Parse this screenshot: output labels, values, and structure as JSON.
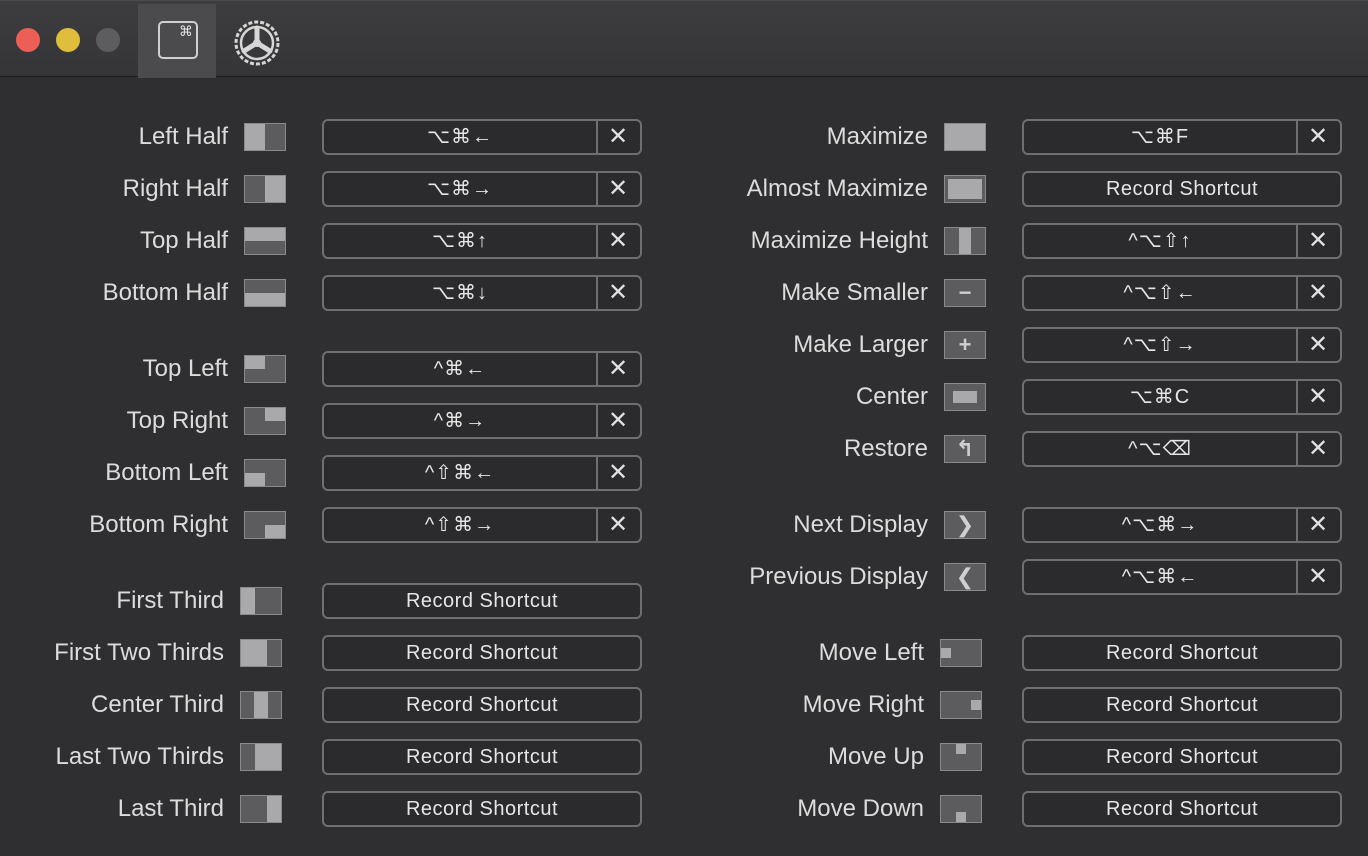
{
  "titlebar": {
    "keyboard_tab_symbol": "⌘",
    "icons": [
      "keyboard-shortcuts-icon",
      "gear-icon"
    ]
  },
  "record_placeholder": "Record Shortcut",
  "clear_symbol": "✕",
  "left_column": [
    {
      "label": "Left Half",
      "icon": "left-half-icon",
      "shortcut": "⌥⌘←"
    },
    {
      "label": "Right Half",
      "icon": "right-half-icon",
      "shortcut": "⌥⌘→"
    },
    {
      "label": "Top Half",
      "icon": "top-half-icon",
      "shortcut": "⌥⌘↑"
    },
    {
      "label": "Bottom Half",
      "icon": "bottom-half-icon",
      "shortcut": "⌥⌘↓"
    },
    {
      "label": "Top Left",
      "icon": "top-left-icon",
      "shortcut": "^⌘←"
    },
    {
      "label": "Top Right",
      "icon": "top-right-icon",
      "shortcut": "^⌘→"
    },
    {
      "label": "Bottom Left",
      "icon": "bottom-left-icon",
      "shortcut": "^⇧⌘←"
    },
    {
      "label": "Bottom Right",
      "icon": "bottom-right-icon",
      "shortcut": "^⇧⌘→"
    },
    {
      "label": "First Third",
      "icon": "first-third-icon",
      "shortcut": ""
    },
    {
      "label": "First Two Thirds",
      "icon": "first-two-thirds-icon",
      "shortcut": ""
    },
    {
      "label": "Center Third",
      "icon": "center-third-icon",
      "shortcut": ""
    },
    {
      "label": "Last Two Thirds",
      "icon": "last-two-thirds-icon",
      "shortcut": ""
    },
    {
      "label": "Last Third",
      "icon": "last-third-icon",
      "shortcut": ""
    }
  ],
  "right_column": [
    {
      "label": "Maximize",
      "icon": "maximize-icon",
      "shortcut": "⌥⌘F"
    },
    {
      "label": "Almost Maximize",
      "icon": "almost-maximize-icon",
      "shortcut": ""
    },
    {
      "label": "Maximize Height",
      "icon": "maximize-height-icon",
      "shortcut": "^⌥⇧↑"
    },
    {
      "label": "Make Smaller",
      "icon": "make-smaller-icon",
      "shortcut": "^⌥⇧←"
    },
    {
      "label": "Make Larger",
      "icon": "make-larger-icon",
      "shortcut": "^⌥⇧→"
    },
    {
      "label": "Center",
      "icon": "center-icon",
      "shortcut": "⌥⌘C"
    },
    {
      "label": "Restore",
      "icon": "restore-icon",
      "shortcut": "^⌥⌫"
    },
    {
      "label": "Next Display",
      "icon": "next-display-icon",
      "shortcut": "^⌥⌘→"
    },
    {
      "label": "Previous Display",
      "icon": "previous-display-icon",
      "shortcut": "^⌥⌘←"
    },
    {
      "label": "Move Left",
      "icon": "move-left-icon",
      "shortcut": ""
    },
    {
      "label": "Move Right",
      "icon": "move-right-icon",
      "shortcut": ""
    },
    {
      "label": "Move Up",
      "icon": "move-up-icon",
      "shortcut": ""
    },
    {
      "label": "Move Down",
      "icon": "move-down-icon",
      "shortcut": ""
    }
  ],
  "colors": {
    "background": "#2f2f31",
    "field_border": "#6f6f71",
    "icon_fill": "#a9a9ab",
    "icon_bg": "#5c5c5e"
  }
}
